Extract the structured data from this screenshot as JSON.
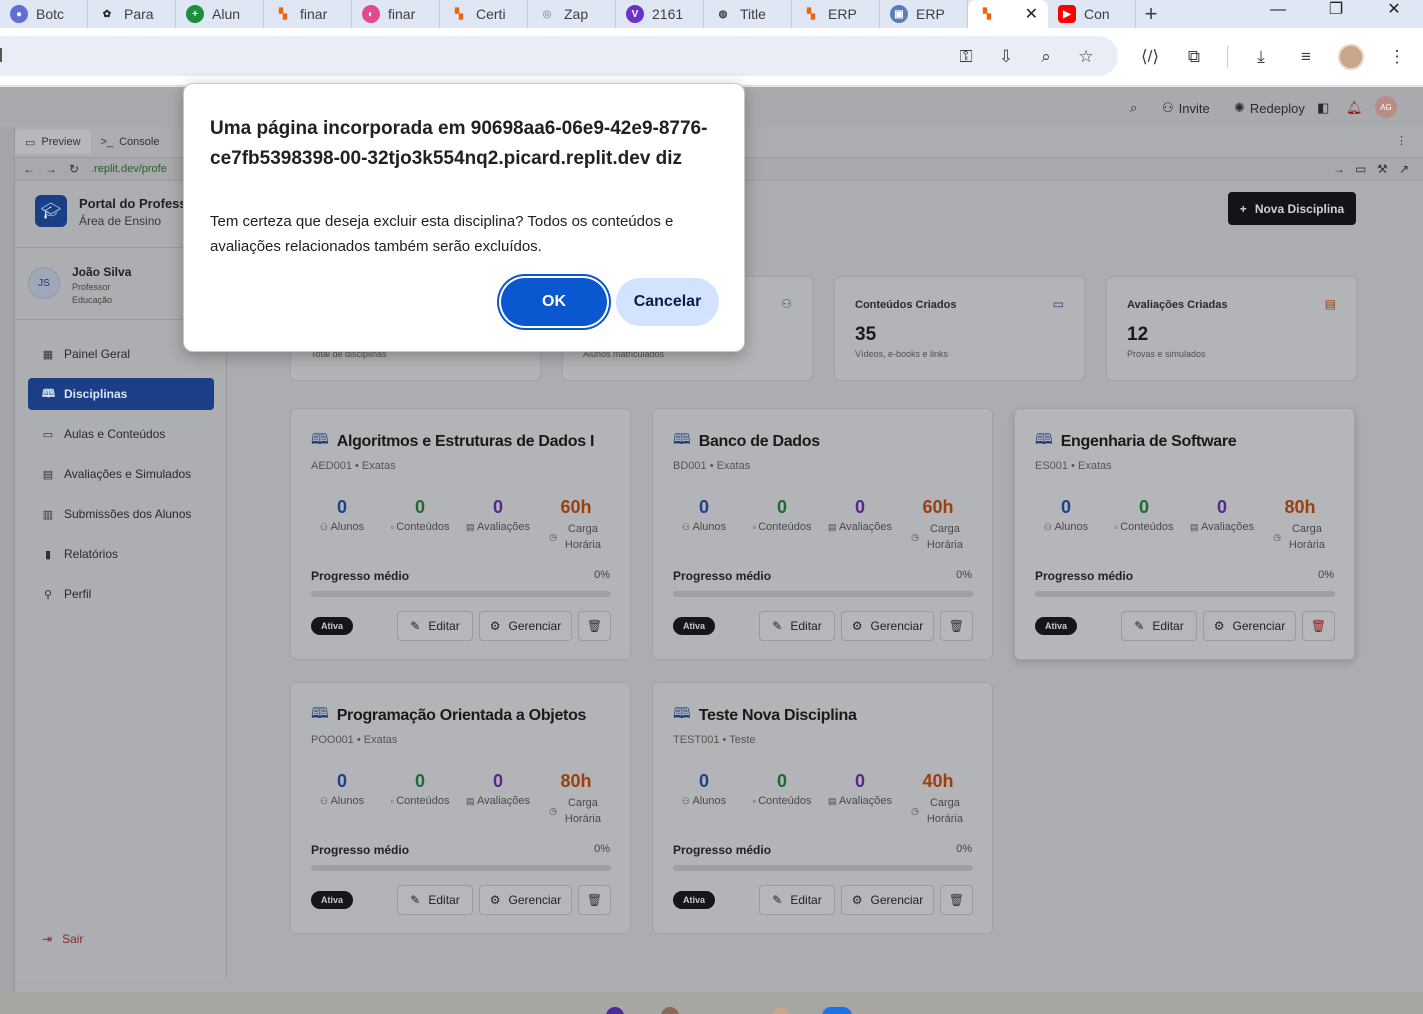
{
  "browser": {
    "tabs": [
      {
        "label": "Botc",
        "icon": "bot-icon",
        "color": "#5f6fd6"
      },
      {
        "label": "Para",
        "icon": "openai-icon",
        "color": "#202124"
      },
      {
        "label": "Alun",
        "icon": "plus-circle-icon",
        "color": "#1e8e3e"
      },
      {
        "label": "finar",
        "icon": "replit-icon",
        "color": "#f26207"
      },
      {
        "label": "finar",
        "icon": "gradient-circle-icon",
        "color": "#e24a8d"
      },
      {
        "label": "Certi",
        "icon": "replit-icon",
        "color": "#f26207"
      },
      {
        "label": "Zap",
        "icon": "zap-icon",
        "color": "#9aa0a6"
      },
      {
        "label": "2161",
        "icon": "v-badge-icon",
        "color": "#6a32c9"
      },
      {
        "label": "Title",
        "icon": "globe-icon",
        "color": "#3c4043"
      },
      {
        "label": "ERP",
        "icon": "replit-icon",
        "color": "#f26207"
      },
      {
        "label": "ERP",
        "icon": "erp-icon",
        "color": "#5a7fb8"
      }
    ],
    "active_tab": {
      "icon": "replit-icon",
      "color": "#f26207",
      "close": "✕"
    },
    "after_tab": {
      "label": "Con",
      "icon": "youtube-icon",
      "color": "#ff0000"
    },
    "new_tab": "+",
    "window_controls": {
      "minimize": "—",
      "maximize": "❐",
      "close": "✕"
    }
  },
  "workspace": {
    "invite": "Invite",
    "redeploy": "Redeploy",
    "avatar": "AG",
    "pane_tabs": [
      "Preview",
      "Console"
    ],
    "url": ".replit.dev/profe"
  },
  "app": {
    "brand_title": "Portal do Professor",
    "brand_sub": "Área de Ensino",
    "user": {
      "initials": "JS",
      "name": "João Silva",
      "role": "Professor",
      "dept": "Educação"
    },
    "nav": [
      {
        "label": "Painel Geral",
        "icon": "grid-icon"
      },
      {
        "label": "Disciplinas",
        "icon": "book-icon",
        "active": true
      },
      {
        "label": "Aulas e Conteúdos",
        "icon": "video-icon"
      },
      {
        "label": "Avaliações e Simulados",
        "icon": "file-icon"
      },
      {
        "label": "Submissões dos Alunos",
        "icon": "clipboard-icon"
      },
      {
        "label": "Relatórios",
        "icon": "chart-icon"
      },
      {
        "label": "Perfil",
        "icon": "user-icon"
      }
    ],
    "logout": "Sair",
    "new_button": "Nova Disciplina",
    "stats": [
      {
        "title": "",
        "value": "",
        "desc": "Total de disciplinas",
        "icon": "book-icon",
        "color": "#1d3f8c"
      },
      {
        "title": "",
        "value": "",
        "desc": "Alunos matriculados",
        "icon": "users-icon",
        "color": "#1d6a32"
      },
      {
        "title": "Conteúdos Criados",
        "value": "35",
        "desc": "Vídeos, e-books e links",
        "icon": "video-icon",
        "color": "#55288c"
      },
      {
        "title": "Avaliações Criadas",
        "value": "12",
        "desc": "Provas e simulados",
        "icon": "file-icon",
        "color": "#9a3f0d"
      }
    ],
    "labels": {
      "alunos": "Alunos",
      "conteudos": "Conteúdos",
      "avaliacoes": "Avaliações",
      "carga": "Carga Horária",
      "progresso": "Progresso médio",
      "editar": "Editar",
      "gerenciar": "Gerenciar"
    },
    "courses": [
      {
        "title": "Algoritmos e Estruturas de Dados I",
        "code": "AED001 • Exatas",
        "alunos": "0",
        "conteudos": "0",
        "avaliacoes": "0",
        "carga": "60h",
        "progress_pct": 0,
        "progress_text": "0%",
        "status": "Ativa"
      },
      {
        "title": "Banco de Dados",
        "code": "BD001 • Exatas",
        "alunos": "0",
        "conteudos": "0",
        "avaliacoes": "0",
        "carga": "60h",
        "progress_pct": 0,
        "progress_text": "0%",
        "status": "Ativa"
      },
      {
        "title": "Engenharia de Software",
        "code": "ES001 • Exatas",
        "alunos": "0",
        "conteudos": "0",
        "avaliacoes": "0",
        "carga": "80h",
        "progress_pct": 0,
        "progress_text": "0%",
        "status": "Ativa",
        "hover": true
      },
      {
        "title": "Programação Orientada a Objetos",
        "code": "POO001 • Exatas",
        "alunos": "0",
        "conteudos": "0",
        "avaliacoes": "0",
        "carga": "80h",
        "progress_pct": 0,
        "progress_text": "0%",
        "status": "Ativa"
      },
      {
        "title": "Teste Nova Disciplina",
        "code": "TEST001 • Teste",
        "alunos": "0",
        "conteudos": "0",
        "avaliacoes": "0",
        "carga": "40h",
        "progress_pct": 0,
        "progress_text": "0%",
        "status": "Ativa"
      }
    ]
  },
  "dialog": {
    "title": "Uma página incorporada em 90698aa6-06e9-42e9-8776-ce7fb5398398-00-32tjo3k554nq2.picard.replit.dev diz",
    "message": "Tem certeza que deseja excluir esta disciplina? Todos os conteúdos e avaliações relacionados também serão excluídos.",
    "ok": "OK",
    "cancel": "Cancelar",
    "ok_color": "#0b57d0",
    "cancel_color": "#d3e3fd"
  }
}
